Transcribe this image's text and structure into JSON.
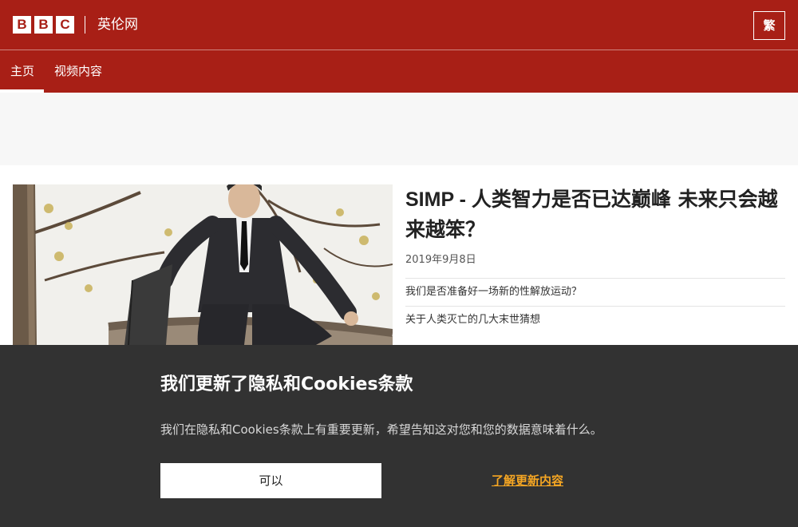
{
  "header": {
    "logo_letters": [
      "B",
      "B",
      "C"
    ],
    "site_name": "英伦网",
    "lang_button_label": "繁"
  },
  "nav": {
    "items": [
      {
        "label": "主页",
        "active": true
      },
      {
        "label": "视频内容",
        "active": false
      }
    ]
  },
  "story": {
    "title_prefix": "SIMP - ",
    "title": "人类智力是否已达巅峰 未来只会越来越笨？",
    "date": "2019年9月8日",
    "related": [
      "我们是否准备好一场新的性解放运动？",
      "关于人类灭亡的几大末世猜想"
    ]
  },
  "cookie_banner": {
    "title": "我们更新了隐私和Cookies条款",
    "text": "我们在隐私和Cookies条款上有重要更新，希望告知这对您和您的数据意味着什么。",
    "ok_label": "可以",
    "learn_more_label": "了解更新内容"
  },
  "colors": {
    "brand_red": "#a81f16",
    "banner_bg": "#323232",
    "link_orange": "#f5a623"
  }
}
